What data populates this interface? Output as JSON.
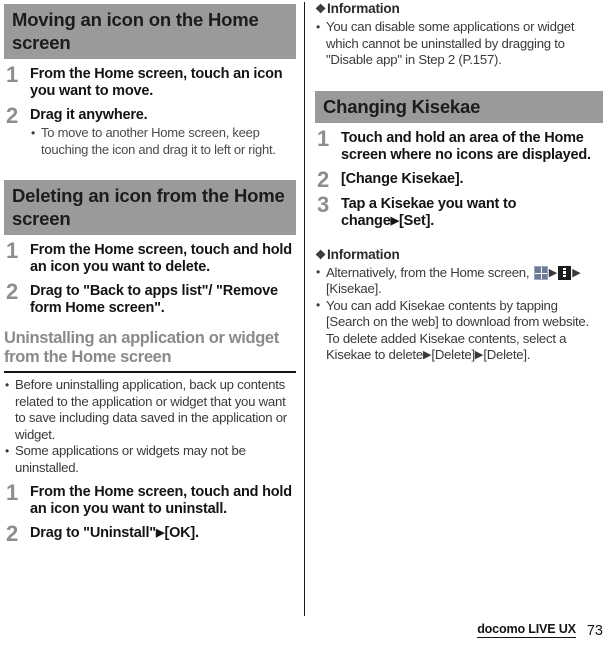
{
  "document": {
    "footer": {
      "brand": "docomo LIVE UX",
      "page_number": "73"
    }
  },
  "left_column": {
    "section_moving": {
      "heading": "Moving an icon on the Home screen",
      "steps": [
        {
          "number": "1",
          "title": "From the Home screen, touch an icon you want to move.",
          "bullets": []
        },
        {
          "number": "2",
          "title": "Drag it anywhere.",
          "bullets": [
            "To move to another Home screen, keep touching the icon and drag it to left or right."
          ]
        }
      ]
    },
    "section_deleting": {
      "heading": "Deleting an icon from the Home screen",
      "steps": [
        {
          "number": "1",
          "title": "From the Home screen, touch and hold an icon you want to delete.",
          "bullets": []
        },
        {
          "number": "2",
          "title": "Drag to \"Back to apps list\"/ \"Remove form Home screen\".",
          "bullets": []
        }
      ]
    },
    "subsection_uninstalling": {
      "heading": "Uninstalling an application or widget from the Home screen",
      "bullets": [
        "Before uninstalling application, back up contents related to the application or widget that you want to save including data saved in the application or widget.",
        "Some applications or widgets may not be uninstalled."
      ],
      "steps": [
        {
          "number": "1",
          "title": "From the Home screen, touch and hold an icon you want to uninstall."
        },
        {
          "number": "2",
          "title_part1": "Drag to \"Uninstall\"",
          "arrow": "▶",
          "title_part2": "[OK]."
        }
      ]
    }
  },
  "right_column": {
    "information_top": {
      "glyph": "❖",
      "heading": "Information",
      "bullets": [
        "You can disable some applications or widget which cannot be uninstalled by dragging to \"Disable app\" in Step 2 (P.157)."
      ]
    },
    "section_kisekae": {
      "heading": "Changing Kisekae",
      "steps": [
        {
          "number": "1",
          "title": "Touch and hold an area of the Home screen where no icons are displayed."
        },
        {
          "number": "2",
          "title": "[Change Kisekae]."
        },
        {
          "number": "3",
          "title_part1": "Tap a Kisekae you want to change",
          "arrow": "▶",
          "title_part2": "[Set]."
        }
      ]
    },
    "information_bottom": {
      "glyph": "❖",
      "heading": "Information",
      "bullet_1": {
        "text_before": "Alternatively, from the Home screen,",
        "icon_apps": "apps-grid-icon",
        "arrow_1": "▶",
        "icon_menu": "overflow-menu-icon",
        "arrow_2": "▶",
        "text_after": "[Kisekae]."
      },
      "bullet_2": {
        "text_before": "You can add Kisekae contents by tapping [Search on the web] to download from website. To delete added Kisekae contents, select a Kisekae to delete",
        "arrow_1": "▶",
        "text_middle": "[Delete]",
        "arrow_2": "▶",
        "text_after": "[Delete]."
      }
    }
  },
  "colors": {
    "section_bar_bg": "#9a9a9a",
    "step_number": "#8d8d8d",
    "subhead_gray": "#8a8a8a",
    "apps_icon": "#6b7a99",
    "menu_icon": "#1c1c1c",
    "rule": "#141414"
  }
}
